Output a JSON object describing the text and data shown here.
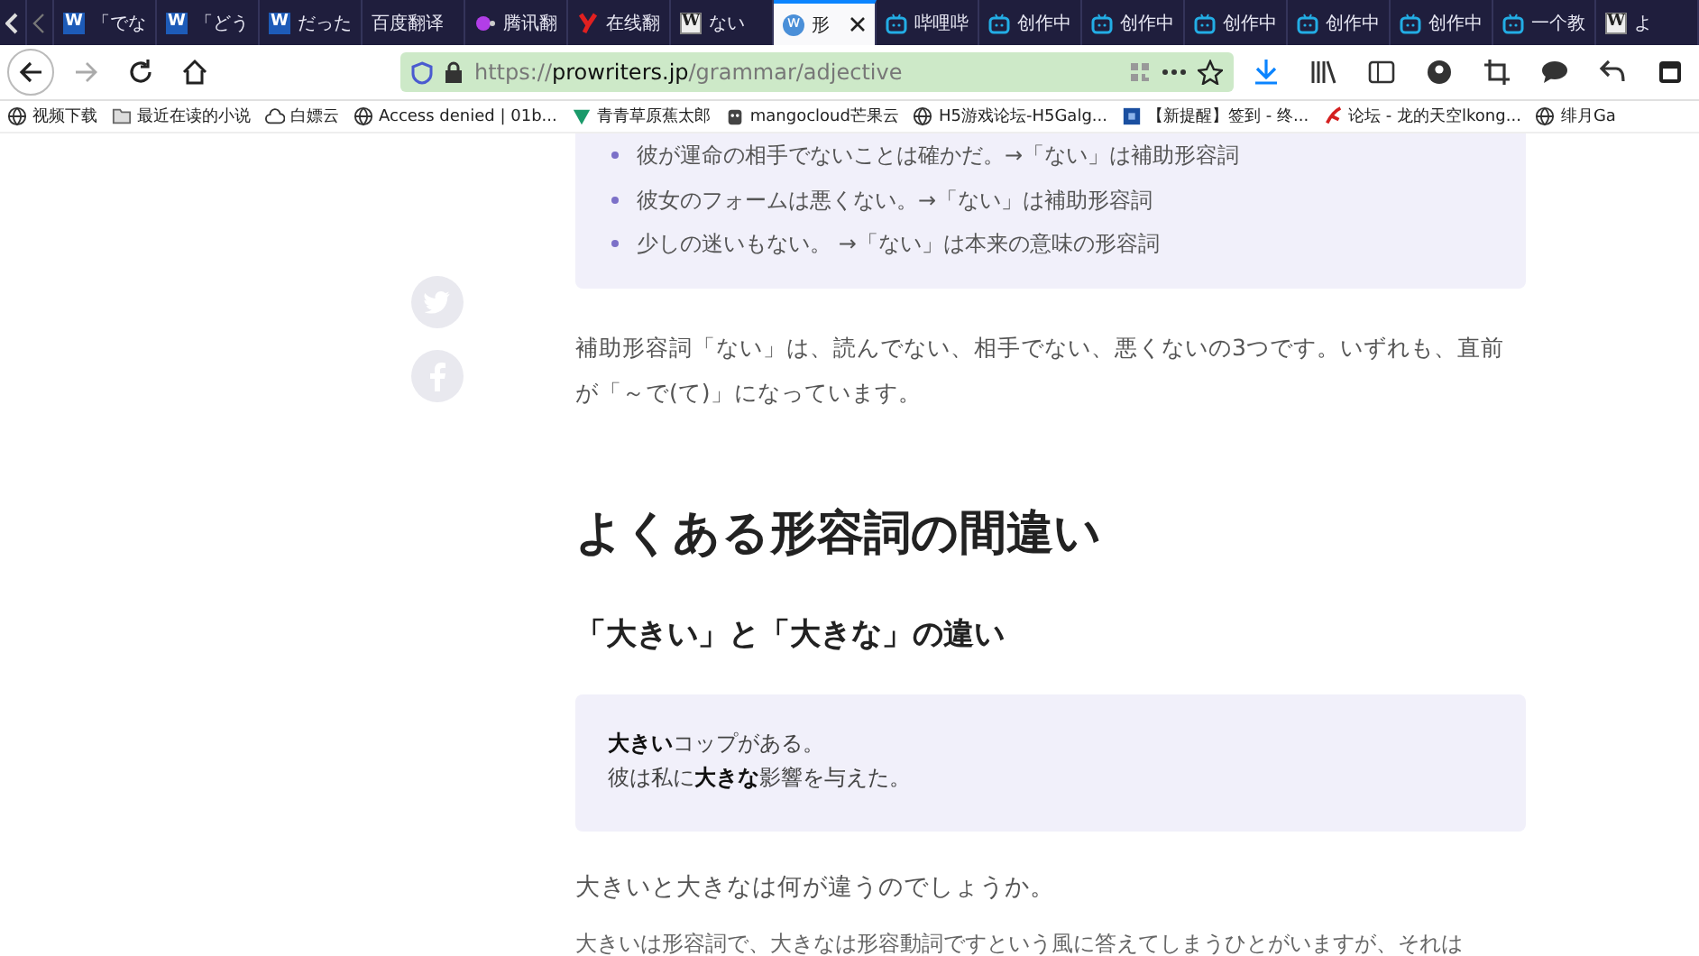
{
  "tabs": [
    {
      "label": "「でな",
      "kind": "square",
      "favicon_letter": "W",
      "selected": false
    },
    {
      "label": "「どう",
      "kind": "square",
      "favicon_letter": "W",
      "selected": false
    },
    {
      "label": "だった",
      "kind": "square",
      "favicon_letter": "W",
      "selected": false
    },
    {
      "label": "百度翻译",
      "kind": "plain",
      "selected": false
    },
    {
      "label": "腾讯翻",
      "kind": "dot",
      "selected": false
    },
    {
      "label": "在线翻",
      "kind": "fork",
      "selected": false
    },
    {
      "label": "ない",
      "kind": "framed",
      "favicon_letter": "W",
      "selected": false
    },
    {
      "label": "形",
      "kind": "round",
      "favicon_letter": "w",
      "selected": true
    },
    {
      "label": "哔哩哔",
      "kind": "tv",
      "selected": false
    },
    {
      "label": "创作中",
      "kind": "tv",
      "selected": false
    },
    {
      "label": "创作中",
      "kind": "tv",
      "selected": false
    },
    {
      "label": "创作中",
      "kind": "tv",
      "selected": false
    },
    {
      "label": "创作中",
      "kind": "tv",
      "selected": false
    },
    {
      "label": "创作中",
      "kind": "tv",
      "selected": false
    },
    {
      "label": "一个教",
      "kind": "tv",
      "selected": false
    },
    {
      "label": "よ",
      "kind": "framed",
      "favicon_letter": "W",
      "selected": false
    }
  ],
  "address": {
    "scheme": "https://",
    "domain": "prowriters.jp",
    "path": "/grammar/adjective"
  },
  "bookmarks": [
    {
      "label": "视频下载",
      "kind": "globe"
    },
    {
      "label": "最近在读的小说",
      "kind": "folder"
    },
    {
      "label": "白嫖云",
      "kind": "cloud"
    },
    {
      "label": "Access denied | 01b...",
      "kind": "globe"
    },
    {
      "label": "青青草原蕉太郎",
      "kind": "leaf"
    },
    {
      "label": "mangocloud芒果云",
      "kind": "mascot"
    },
    {
      "label": "H5游戏论坛-H5Galg...",
      "kind": "globe"
    },
    {
      "label": "【新提醒】签到 - 终...",
      "kind": "square"
    },
    {
      "label": "论坛 - 龙的天空lkong...",
      "kind": "brush"
    },
    {
      "label": "绯月Ga",
      "kind": "globe"
    }
  ],
  "article": {
    "list_items": [
      "彼が運命の相手でないことは確かだ。→「ない」は補助形容詞",
      "彼女のフォームは悪くない。→「ない」は補助形容詞",
      "少しの迷いもない。 →「ない」は本来の意味の形容詞"
    ],
    "paragraph": "補助形容詞「ない」は、読んでない、相手でない、悪くないの3つです。いずれも、直前が「～で(て)」になっています。",
    "heading": "よくある形容詞の間違い",
    "subheading": "「大きい」と「大きな」の違い",
    "examples": [
      "**大きい**コップがある。",
      "彼は私に**大きな**影響を与えた。"
    ],
    "question": "大きいと大きなは何が違うのでしょうか。",
    "cut_line": "大きいは形容詞で、大きなは形容動詞ですという風に答えてしまうひとがいますが、それは"
  }
}
